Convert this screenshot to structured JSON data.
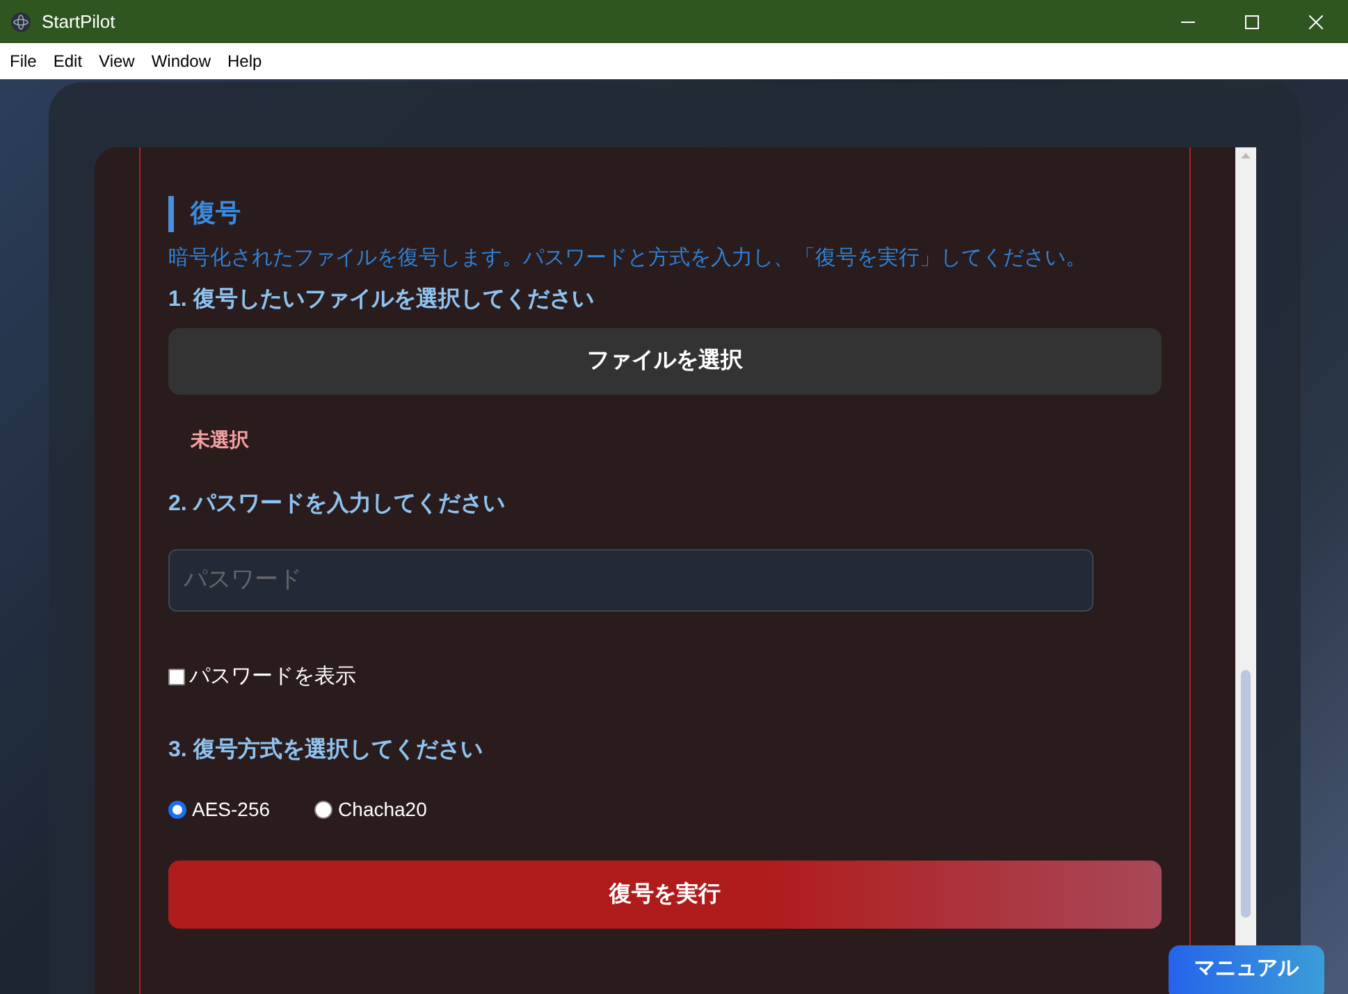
{
  "window": {
    "title": "StartPilot"
  },
  "menu": [
    "File",
    "Edit",
    "View",
    "Window",
    "Help"
  ],
  "section": {
    "title": "復号",
    "description": "暗号化されたファイルを復号します。パスワードと方式を入力し、「復号を実行」してください。"
  },
  "step1": {
    "label": "1. 復号したいファイルを選択してください",
    "button": "ファイルを選択",
    "status": "未選択"
  },
  "step2": {
    "label": "2. パスワードを入力してください",
    "placeholder": "パスワード",
    "show_password": {
      "label": "パスワードを表示",
      "checked": false
    }
  },
  "step3": {
    "label": "3. 復号方式を選択してください",
    "options": [
      {
        "label": "AES-256",
        "selected": true
      },
      {
        "label": "Chacha20",
        "selected": false
      }
    ]
  },
  "run_button": "復号を実行",
  "manual_button": "マニュアル"
}
